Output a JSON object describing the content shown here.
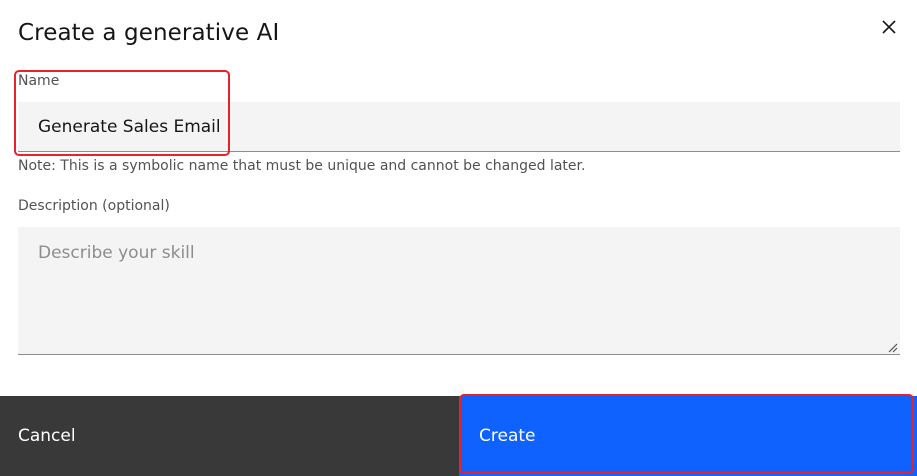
{
  "dialog": {
    "title": "Create a generative AI",
    "close_icon": "close-icon"
  },
  "name_field": {
    "label": "Name",
    "value": "Generate Sales Email",
    "note": "Note: This is a symbolic name that must be unique and cannot be changed later."
  },
  "description_field": {
    "label": "Description (optional)",
    "placeholder": "Describe your skill",
    "value": ""
  },
  "footer": {
    "cancel_label": "Cancel",
    "create_label": "Create"
  },
  "colors": {
    "primary": "#0f62fe",
    "secondary": "#393939",
    "highlight": "#e8212a",
    "field_bg": "#f4f4f4"
  }
}
